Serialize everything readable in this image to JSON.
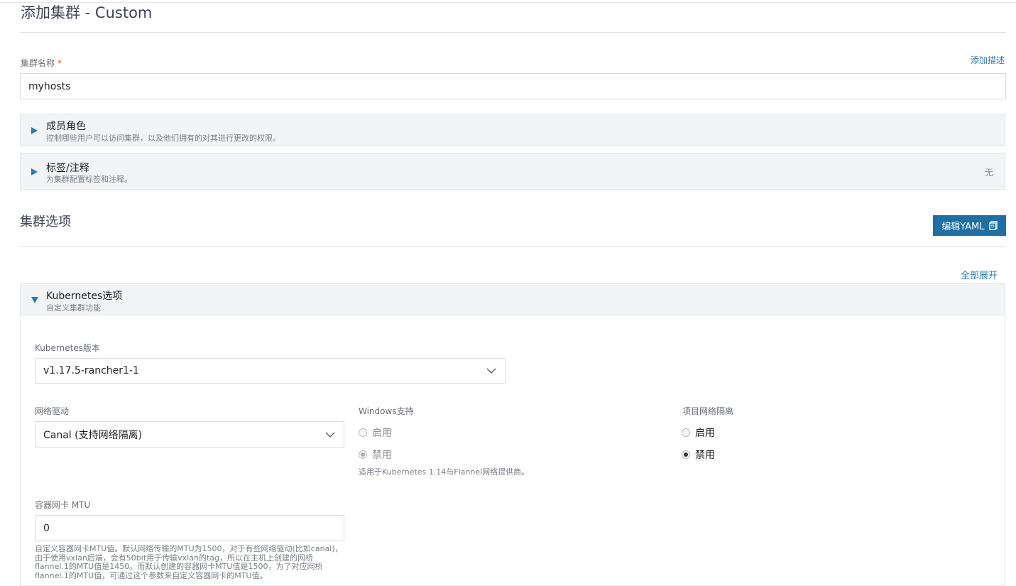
{
  "page": {
    "title": "添加集群 - Custom"
  },
  "cluster_name": {
    "label": "集群名称",
    "required_mark": "*",
    "value": "myhosts",
    "add_description_link": "添加描述"
  },
  "accordions": {
    "member_roles": {
      "title": "成员角色",
      "subtitle": "控制哪些用户可以访问集群，以及他们拥有的对其进行更改的权限。"
    },
    "labels": {
      "title": "标签/注释",
      "subtitle": "为集群配置标签和注释。",
      "status": "无"
    }
  },
  "cluster_options": {
    "title": "集群选项",
    "edit_yaml_label": "编辑YAML",
    "expand_all_link": "全部展开"
  },
  "kubernetes_options": {
    "title": "Kubernetes选项",
    "subtitle": "自定义集群功能",
    "version": {
      "label": "Kubernetes版本",
      "value": "v1.17.5-rancher1-1"
    },
    "network_provider": {
      "label": "网络驱动",
      "value": "Canal (支持网络隔离)"
    },
    "windows_support": {
      "label": "Windows支持",
      "enable_label": "启用",
      "disable_label": "禁用",
      "selected": "disable",
      "disabled": true,
      "help": "适用于Kubernetes 1.14与Flannel网络提供商。"
    },
    "project_isolation": {
      "label": "项目网络隔离",
      "enable_label": "启用",
      "disable_label": "禁用",
      "selected": "disable"
    },
    "mtu": {
      "label": "容器网卡 MTU",
      "value": "0",
      "help": "自定义容器网卡MTU值。默认网络传输的MTU为1500，对于有些网络驱动(比如canal)，由于使用vxlan后端，会有50bit用于传输vxlan的tag，所以在主机上创建的网桥flannel.1的MTU值是1450。而默认创建的容器网卡MTU值是1500，为了对应网桥flannel.1的MTU值，可通过这个参数来自定义容器网卡的MTU值。"
    }
  },
  "colors": {
    "accent": "#2b7bb9",
    "primary_button": "#1d6fa5",
    "accordion_bg": "#f2f4f5",
    "required": "#f0453a"
  }
}
